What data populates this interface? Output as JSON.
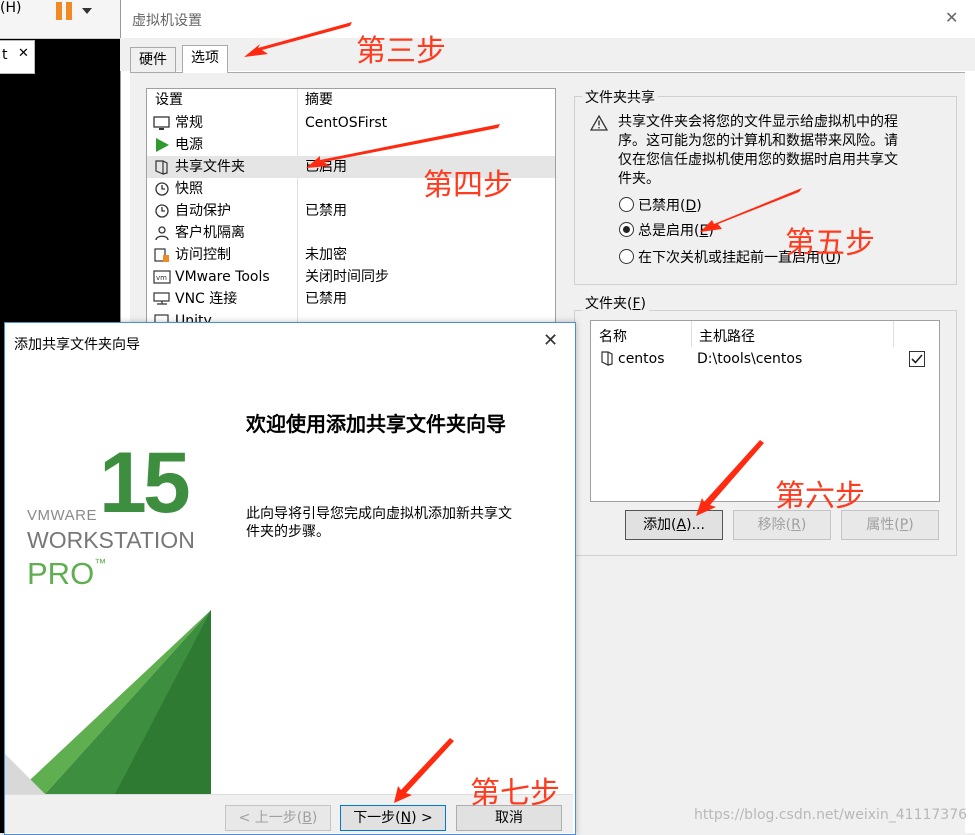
{
  "host": {
    "menu_item": "(H)",
    "tab_fragment": "t"
  },
  "settings": {
    "title": "虚拟机设置",
    "close": "✕",
    "tabs": [
      {
        "label": "硬件"
      },
      {
        "label": "选项"
      }
    ],
    "list": {
      "col_setting": "设置",
      "col_summary": "摘要",
      "rows": [
        {
          "name": "常规",
          "summary": "CentOSFirst",
          "icon": "monitor-icon"
        },
        {
          "name": "电源",
          "summary": "",
          "icon": "play-icon"
        },
        {
          "name": "共享文件夹",
          "summary": "已启用",
          "icon": "folder-icon"
        },
        {
          "name": "快照",
          "summary": "",
          "icon": "clock-icon"
        },
        {
          "name": "自动保护",
          "summary": "已禁用",
          "icon": "clock-icon"
        },
        {
          "name": "客户机隔离",
          "summary": "",
          "icon": "user-icon"
        },
        {
          "name": "访问控制",
          "summary": "未加密",
          "icon": "lock-icon"
        },
        {
          "name": "VMware Tools",
          "summary": "关闭时间同步",
          "icon": "vm-icon"
        },
        {
          "name": "VNC 连接",
          "summary": "已禁用",
          "icon": "network-icon"
        },
        {
          "name": "Unity",
          "summary": "",
          "icon": "unity-icon"
        }
      ]
    },
    "share_group": {
      "label": "文件夹共享",
      "description": "共享文件夹会将您的文件显示给虚拟机中的程序。这可能为您的计算机和数据带来风险。请仅在您信任虚拟机使用您的数据时启用共享文件夹。",
      "options": [
        {
          "text": "已禁用(",
          "key": "D",
          "end": ")",
          "selected": false
        },
        {
          "text": "总是启用(",
          "key": "E",
          "end": ")",
          "selected": true
        },
        {
          "text": "在下次关机或挂起前一直启用(",
          "key": "U",
          "end": ")",
          "selected": false
        }
      ]
    },
    "folders_group": {
      "label_text": "文件夹(",
      "label_key": "F",
      "label_end": ")",
      "col_name": "名称",
      "col_path": "主机路径",
      "rows": [
        {
          "name": "centos",
          "path": "D:\\tools\\centos",
          "checked": true
        }
      ],
      "buttons": {
        "add": {
          "text": "添加(",
          "key": "A",
          "end": ")..."
        },
        "remove": {
          "text": "移除(",
          "key": "R",
          "end": ")"
        },
        "props": {
          "text": "属性(",
          "key": "P",
          "end": ")"
        }
      }
    }
  },
  "wizard": {
    "title": "添加共享文件夹向导",
    "close": "✕",
    "brand": {
      "number": "15",
      "line1": "VMWARE",
      "line2": "WORKSTATION",
      "line3": "PRO",
      "tm": "™"
    },
    "heading": "欢迎使用添加共享文件夹向导",
    "description": "此向导将引导您完成向虚拟机添加新共享文件夹的步骤。",
    "buttons": {
      "back": {
        "text": "< 上一步(",
        "key": "B",
        "end": ")"
      },
      "next": {
        "text": "下一步(",
        "key": "N",
        "end": ") >"
      },
      "cancel": "取消"
    }
  },
  "annotations": {
    "steps": [
      "第三步",
      "第四步",
      "第五步",
      "第六步",
      "第七步"
    ],
    "color": "#ff3b1f"
  },
  "watermark": "https://blog.csdn.net/weixin_41117376",
  "colors": {
    "vmware_green": "#3d8f3f",
    "accent_blue": "#4a90d9"
  }
}
